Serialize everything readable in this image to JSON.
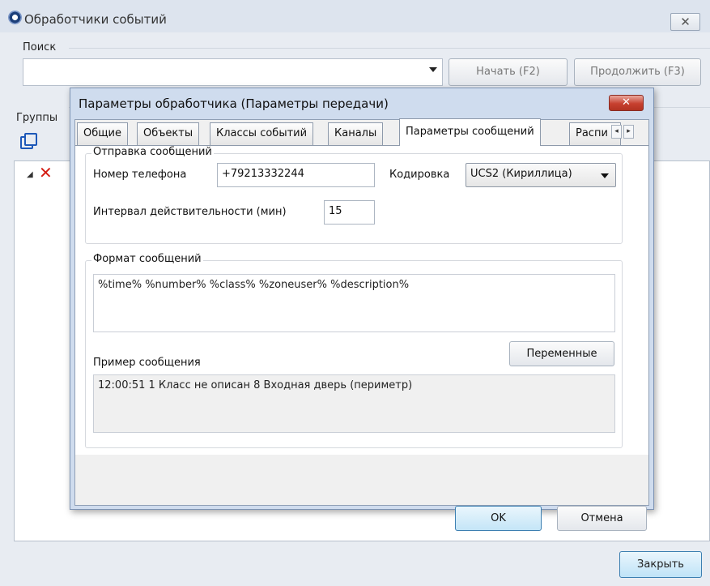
{
  "main_window": {
    "title": "Обработчики событий",
    "close_symbol": "✕",
    "search": {
      "label": "Поиск",
      "value": "",
      "start_button": "Начать (F2)",
      "continue_button": "Продолжить (F3)"
    },
    "groups_label": "Группы",
    "close_button": "Закрыть"
  },
  "dialog": {
    "title": "Параметры обработчика (Параметры передачи)",
    "close_symbol": "✕",
    "tabs": [
      {
        "label": "Общие"
      },
      {
        "label": "Объекты"
      },
      {
        "label": "Классы событий"
      },
      {
        "label": "Каналы"
      },
      {
        "label": "Параметры сообщений",
        "active": true
      },
      {
        "label": "Распи"
      }
    ],
    "sending": {
      "legend": "Отправка сообщений",
      "phone_label": "Номер телефона",
      "phone_value": "+79213332244",
      "encoding_label": "Кодировка",
      "encoding_value": "UCS2 (Кириллица)",
      "interval_label": "Интервал действительности (мин)",
      "interval_value": "15"
    },
    "format": {
      "legend": "Формат сообщений",
      "template": "%time% %number% %class% %zoneuser% %description%",
      "variables_button": "Переменные",
      "example_label": "Пример сообщения",
      "example_value": "12:00:51 1 Класс не описан 8 Входная дверь (периметр)"
    },
    "ok_button": "OK",
    "cancel_button": "Отмена"
  },
  "icons": {
    "app": "gear-icon",
    "copy": "copy-icon",
    "tree_item": "red-x-icon",
    "tab_scroll_left": "◂",
    "tab_scroll_right": "▸"
  }
}
